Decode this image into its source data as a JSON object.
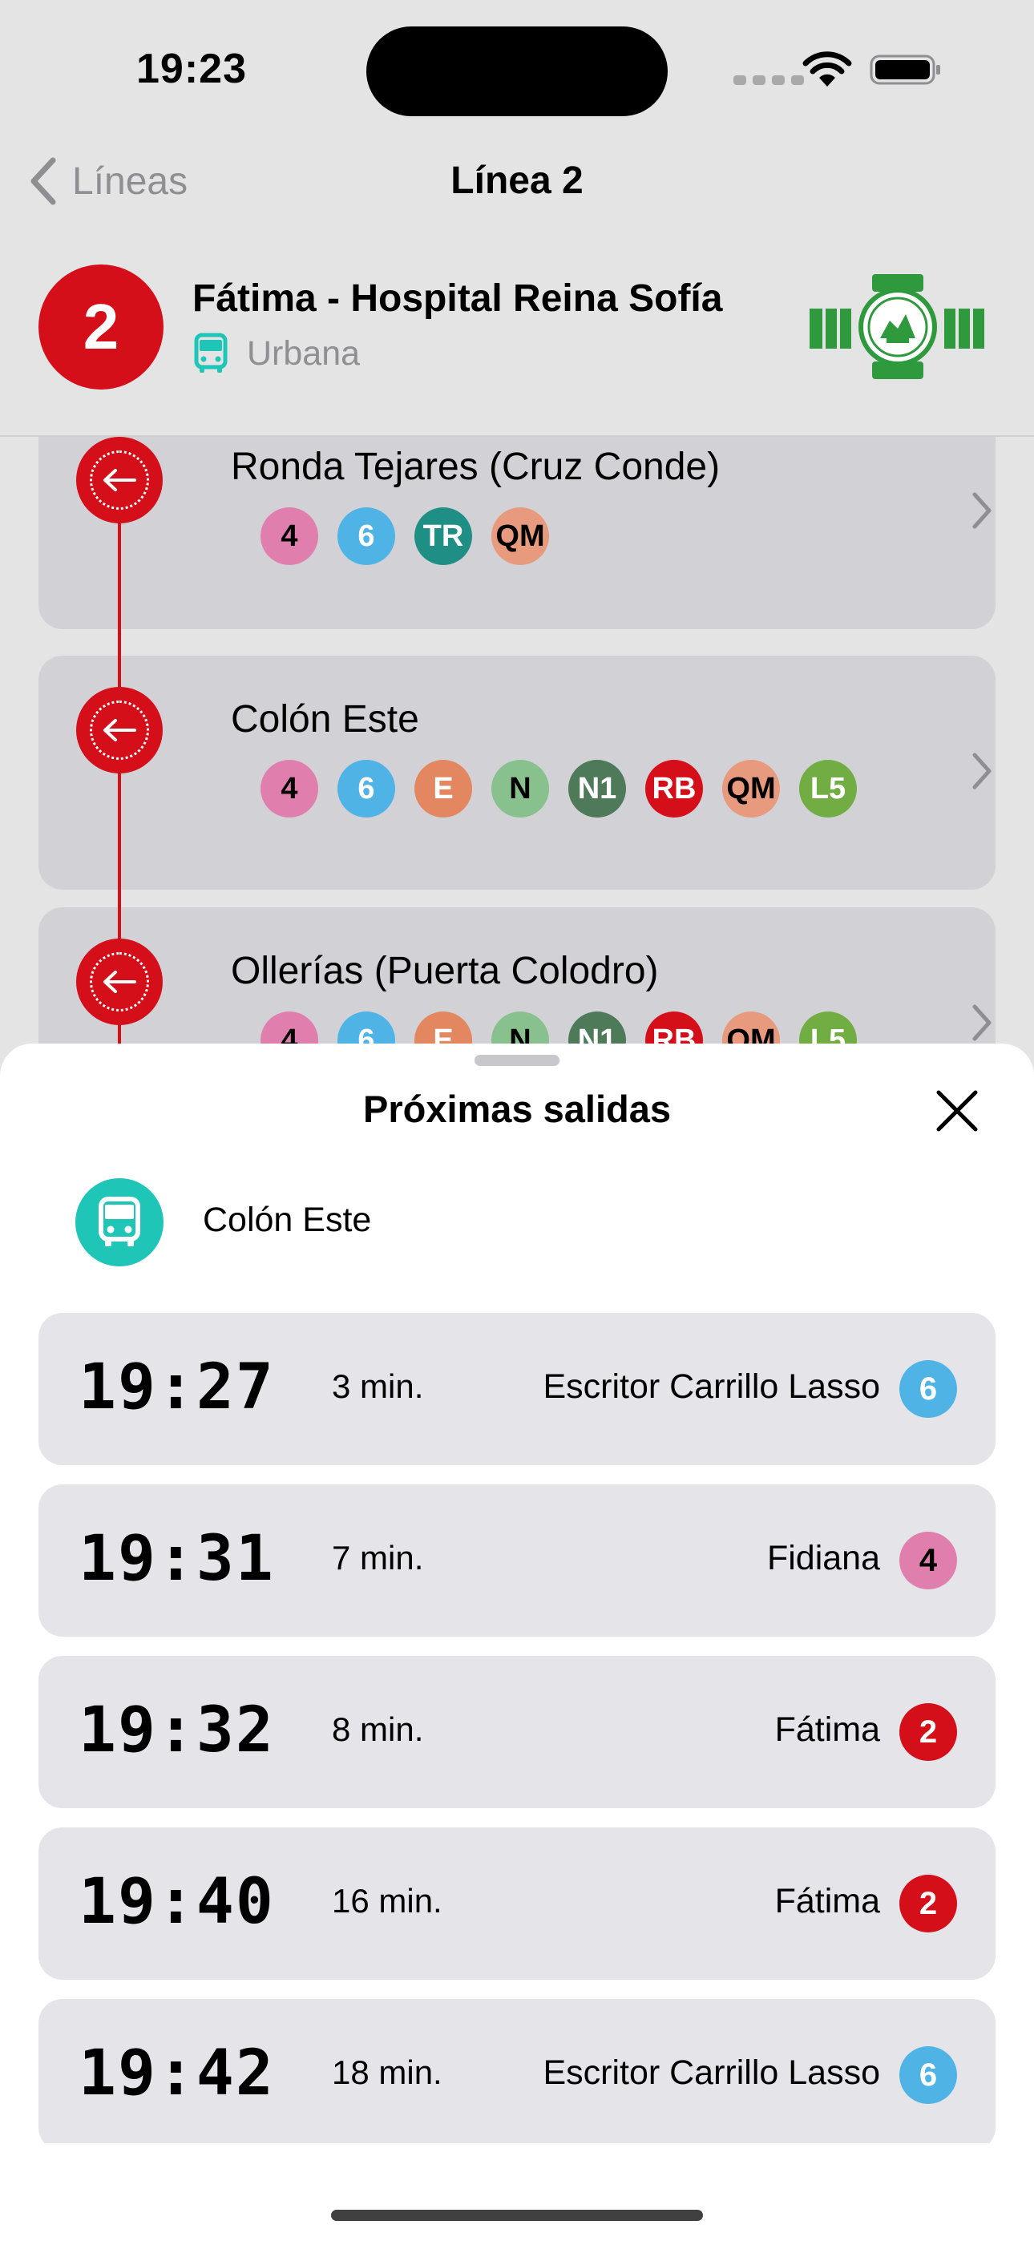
{
  "status_bar": {
    "time": "19:23"
  },
  "nav": {
    "back_label": "Líneas",
    "title": "Línea 2"
  },
  "line": {
    "number": "2",
    "name": "Fátima - Hospital Reina Sofía",
    "type": "Urbana",
    "badge_color": "#d40f1a",
    "operator_logo": "aucorsa-logo"
  },
  "stops": [
    {
      "name": "Ronda Tejares (Cruz Conde)",
      "lines": [
        {
          "label": "4",
          "color": "#e07fae"
        },
        {
          "label": "6",
          "color": "#4fb3e6"
        },
        {
          "label": "TR",
          "color": "#1f8e85"
        },
        {
          "label": "QM",
          "color": "#e79a7e"
        }
      ]
    },
    {
      "name": "Colón Este",
      "lines": [
        {
          "label": "4",
          "color": "#e07fae"
        },
        {
          "label": "6",
          "color": "#4fb3e6"
        },
        {
          "label": "E",
          "color": "#e2875f"
        },
        {
          "label": "N",
          "color": "#88c08e"
        },
        {
          "label": "N1",
          "color": "#4e7a5a"
        },
        {
          "label": "RB",
          "color": "#d40f1a"
        },
        {
          "label": "QM",
          "color": "#e79a7e"
        },
        {
          "label": "L5",
          "color": "#72ad44"
        }
      ]
    },
    {
      "name": "Ollerías (Puerta Colodro)",
      "lines": [
        {
          "label": "4",
          "color": "#e07fae"
        },
        {
          "label": "6",
          "color": "#4fb3e6"
        },
        {
          "label": "E",
          "color": "#e2875f"
        },
        {
          "label": "N",
          "color": "#88c08e"
        },
        {
          "label": "N1",
          "color": "#4e7a5a"
        },
        {
          "label": "RB",
          "color": "#d40f1a"
        },
        {
          "label": "QM",
          "color": "#e79a7e"
        },
        {
          "label": "L5",
          "color": "#72ad44"
        }
      ]
    }
  ],
  "sheet": {
    "title": "Próximas salidas",
    "stop_name": "Colón Este",
    "stop_icon_color": "#1fc6b7",
    "departures": [
      {
        "time": "19:27",
        "minutes": "3 min.",
        "destination": "Escritor Carrillo Lasso",
        "line": "6",
        "color": "#4fb3e6",
        "text_color": "#fff"
      },
      {
        "time": "19:31",
        "minutes": "7 min.",
        "destination": "Fidiana",
        "line": "4",
        "color": "#e07fae",
        "text_color": "#000"
      },
      {
        "time": "19:32",
        "minutes": "8 min.",
        "destination": "Fátima",
        "line": "2",
        "color": "#d40f1a",
        "text_color": "#fff"
      },
      {
        "time": "19:40",
        "minutes": "16 min.",
        "destination": "Fátima",
        "line": "2",
        "color": "#d40f1a",
        "text_color": "#fff"
      },
      {
        "time": "19:42",
        "minutes": "18 min.",
        "destination": "Escritor Carrillo Lasso",
        "line": "6",
        "color": "#4fb3e6",
        "text_color": "#fff"
      }
    ]
  }
}
